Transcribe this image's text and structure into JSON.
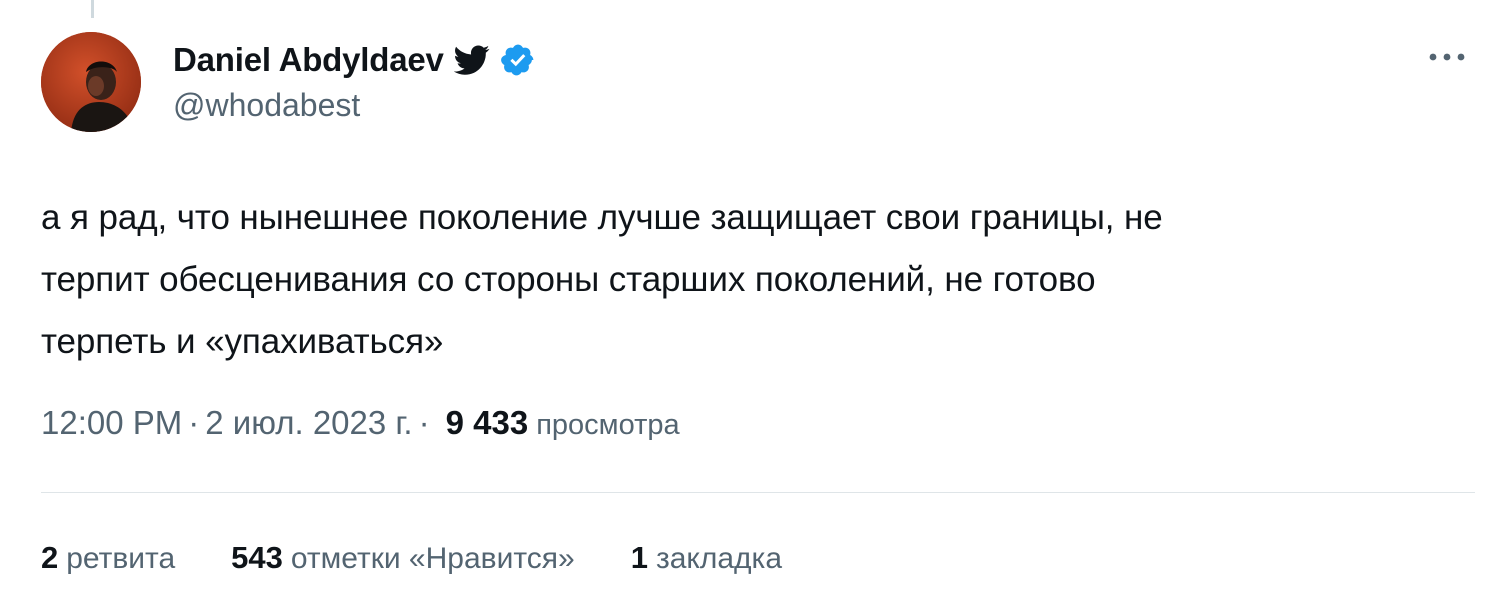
{
  "tweet": {
    "author": {
      "display_name": "Daniel Abdyldaev",
      "handle": "@whodabest",
      "verified": true,
      "icons": [
        "twitter-bird-icon",
        "verified-badge-icon"
      ]
    },
    "text_lines": [
      "а я рад, что нынешнее поколение лучше защищает свои границы, не",
      "терпит обесценивания со стороны старших поколений, не готово",
      "терпеть и «упахиваться»"
    ],
    "meta": {
      "time": "12:00 PM",
      "date": "2 июл. 2023 г.",
      "separator": "·",
      "views_count": "9 433",
      "views_label": "просмотра"
    },
    "stats": {
      "retweets": {
        "count": "2",
        "label": "ретвита"
      },
      "likes": {
        "count": "543",
        "label": "отметки «Нравится»"
      },
      "bookmarks": {
        "count": "1",
        "label": "закладка"
      }
    },
    "more_icon": "more-horizontal-icon"
  },
  "colors": {
    "text_primary": "#0f1419",
    "text_secondary": "#536471",
    "verified_blue": "#1d9bf0",
    "divider": "#dfe5e8"
  }
}
